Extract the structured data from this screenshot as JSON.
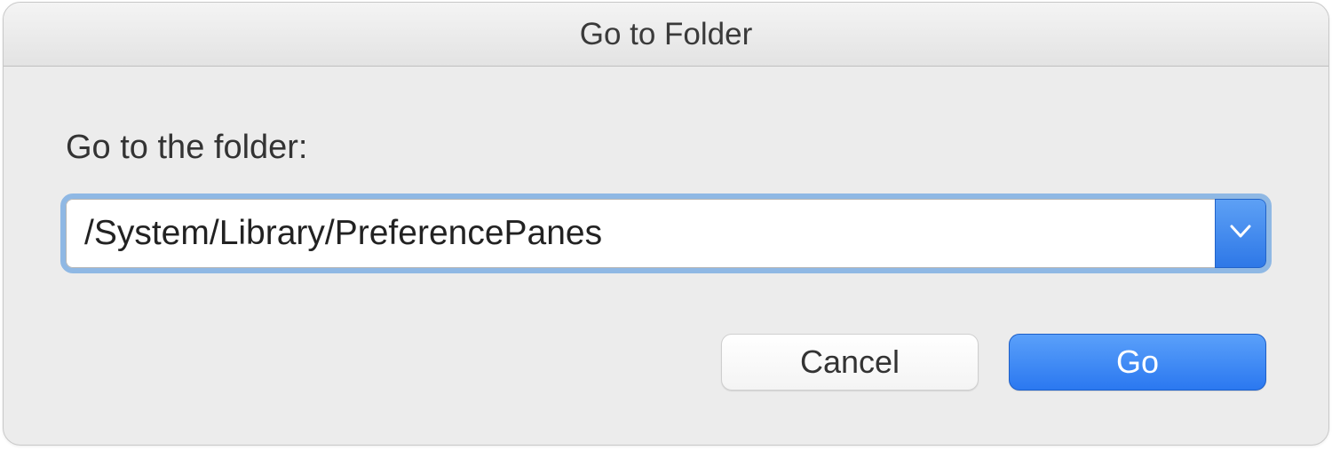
{
  "dialog": {
    "title": "Go to Folder",
    "label": "Go to the folder:",
    "path_value": "/System/Library/PreferencePanes",
    "buttons": {
      "cancel": "Cancel",
      "go": "Go"
    }
  }
}
